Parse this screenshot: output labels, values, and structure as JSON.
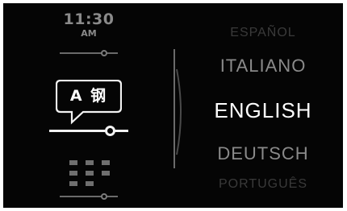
{
  "status": {
    "time": "11:30",
    "ampm": "AM"
  },
  "menu": {
    "language_icon_text": "A 钢",
    "selected_item": "language"
  },
  "languages": {
    "items": [
      "ESPAÑOL",
      "ITALIANO",
      "ENGLISH",
      "DEUTSCH",
      "PORTUGUÊS"
    ],
    "selected": "ENGLISH"
  },
  "colors": {
    "background": "#050505",
    "active": "#ffffff",
    "inactive": "#8a8a8a",
    "faded": "#3a3a3a"
  },
  "icons": {
    "language": "language-bubble-icon",
    "apps": "app-grid-icon"
  }
}
